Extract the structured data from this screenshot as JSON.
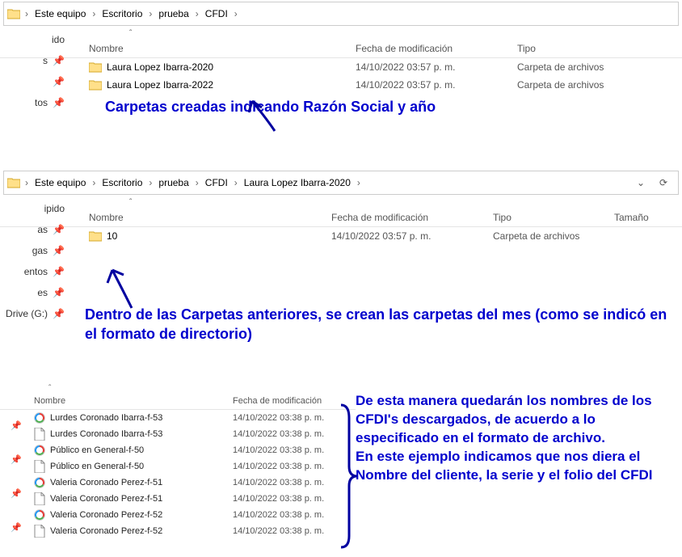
{
  "panel1": {
    "breadcrumb": [
      "Este equipo",
      "Escritorio",
      "prueba",
      "CFDI"
    ],
    "columns": {
      "name": "Nombre",
      "date": "Fecha de modificación",
      "type": "Tipo"
    },
    "rows": [
      {
        "name": "Laura Lopez Ibarra-2020",
        "date": "14/10/2022 03:57 p. m.",
        "type": "Carpeta de archivos"
      },
      {
        "name": "Laura Lopez Ibarra-2022",
        "date": "14/10/2022 03:57 p. m.",
        "type": "Carpeta de archivos"
      }
    ],
    "sidebar": [
      "ido",
      "s",
      "tos"
    ],
    "annotation": "Carpetas creadas indicando Razón Social y año"
  },
  "panel2": {
    "breadcrumb": [
      "Este equipo",
      "Escritorio",
      "prueba",
      "CFDI",
      "Laura Lopez Ibarra-2020"
    ],
    "columns": {
      "name": "Nombre",
      "date": "Fecha de modificación",
      "type": "Tipo",
      "size": "Tamaño"
    },
    "rows": [
      {
        "name": "10",
        "date": "14/10/2022 03:57 p. m.",
        "type": "Carpeta de archivos"
      }
    ],
    "sidebar": [
      "ipido",
      "as",
      "gas",
      "entos",
      "es",
      "Drive (G:)"
    ],
    "annotation": "Dentro de las Carpetas anteriores, se crean las carpetas del mes (como se indicó en el formato de directorio)"
  },
  "panel3": {
    "columns": {
      "name": "Nombre",
      "date": "Fecha de modificación"
    },
    "rows": [
      {
        "name": "Lurdes Coronado Ibarra-f-53",
        "date": "14/10/2022 03:38 p. m.",
        "icon": "pdf"
      },
      {
        "name": "Lurdes Coronado Ibarra-f-53",
        "date": "14/10/2022 03:38 p. m.",
        "icon": "file"
      },
      {
        "name": "Público en General-f-50",
        "date": "14/10/2022 03:38 p. m.",
        "icon": "pdf"
      },
      {
        "name": "Público en General-f-50",
        "date": "14/10/2022 03:38 p. m.",
        "icon": "file"
      },
      {
        "name": "Valeria Coronado Perez-f-51",
        "date": "14/10/2022 03:38 p. m.",
        "icon": "pdf"
      },
      {
        "name": "Valeria Coronado Perez-f-51",
        "date": "14/10/2022 03:38 p. m.",
        "icon": "file"
      },
      {
        "name": "Valeria Coronado Perez-f-52",
        "date": "14/10/2022 03:38 p. m.",
        "icon": "pdf"
      },
      {
        "name": "Valeria Coronado Perez-f-52",
        "date": "14/10/2022 03:38 p. m.",
        "icon": "file"
      }
    ],
    "annotation_a": "De esta manera quedarán los nombres de los CFDI's descargados, de acuerdo a lo especificado en el formato de archivo.",
    "annotation_b": "En este ejemplo indicamos que nos diera el Nombre del cliente, la serie y el folio del CFDI"
  }
}
